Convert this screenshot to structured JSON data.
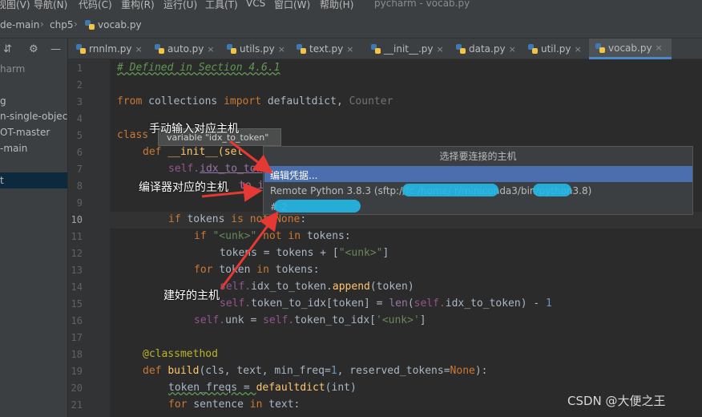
{
  "menu": {
    "items": [
      "视图(V)",
      "导航(N)",
      "代码(C)",
      "重构(R)",
      "运行(U)",
      "工具(T)",
      "VCS",
      "窗口(W)",
      "帮助(H)"
    ],
    "window_title": "pycharm - vocab.py"
  },
  "breadcrumb": [
    "de-main",
    "chp5",
    "vocab.py"
  ],
  "sidebar": {
    "items": [
      "harm",
      "g",
      "n-single-objec",
      "OT-master",
      "-main",
      "t"
    ]
  },
  "tabs": [
    "rnnlm.py",
    "auto.py",
    "utils.py",
    "text.py",
    "__init__.py",
    "data.py",
    "util.py",
    "vocab.py"
  ],
  "active_tab": "vocab.py",
  "line_numbers": [
    "1",
    "2",
    "3",
    "4",
    "5",
    "6",
    "7",
    "8",
    "9",
    "10",
    "11",
    "12",
    "13",
    "14",
    "15",
    "16",
    "17",
    "18",
    "19",
    "20",
    "21"
  ],
  "code": {
    "l1": "# Defined in Section 4.6.1",
    "l3_from": "from",
    "l3_mod": "collections",
    "l3_import": "import",
    "l3_names": "defaultdict,",
    "l3_counter": "Counter",
    "l5_class": "class",
    "l6_def": "def",
    "l6_name": "__init__(sel",
    "l7_self": "self.",
    "l7_attr": "idx_to_tok",
    "l8_rest": "to_i",
    "l10_if": "if",
    "l10_a": "tokens",
    "l10_is": "is not",
    "l10_none": "None",
    "l10_colon": ":",
    "l11_if": "if",
    "l11_str": "\"<unk>\"",
    "l11_not": "not in",
    "l11_rest": "tokens:",
    "l12_a": "tokens = tokens + [",
    "l12_str": "\"<unk>\"",
    "l12_b": "]",
    "l13_for": "for",
    "l13_a": "token",
    "l13_in": "in",
    "l13_b": "tokens:",
    "l14_self": "self.",
    "l14_a": "idx_to_token.",
    "l14_fn": "append",
    "l14_b": "(token)",
    "l15_self": "self.",
    "l15_a": "token_to_idx[token] = ",
    "l15_len": "len",
    "l15_b": "(",
    "l15_self2": "self.",
    "l15_c": "idx_to_token) - ",
    "l15_num": "1",
    "l16_self": "self.",
    "l16_a": "unk = ",
    "l16_self2": "self.",
    "l16_b": "token_to_idx[",
    "l16_str": "'<unk>'",
    "l16_c": "]",
    "l18_dec": "@classmethod",
    "l19_def": "def",
    "l19_fn": "build",
    "l19_a": "(cls, text, min_freq=",
    "l19_n1": "1",
    "l19_b": ", reserved_tokens=",
    "l19_none": "None",
    "l19_c": "):",
    "l20_a": "token_freqs = ",
    "l20_fn": "defaultdict",
    "l20_b": "(int)",
    "l21_for": "for",
    "l21_a": "sentence",
    "l21_in": "in",
    "l21_b": "text:"
  },
  "tooltip": "variable \"idx_to_token\"",
  "popup": {
    "title": "选择要连接的主机",
    "options": [
      "编辑凭据...",
      "Remote Python 3.8.3 (sftp://fc                    /home/        r/miniconda3/bin/python3.8)",
      "#                                 2"
    ]
  },
  "annotations": {
    "a1": "手动输入对应主机",
    "a2": "编译器对应的主机",
    "a3": "建好的主机"
  },
  "colors": {
    "arrow": "#e53935",
    "redaction": "#22b8e8",
    "selection": "#4b6eaf"
  },
  "watermark": "CSDN @大便之王"
}
